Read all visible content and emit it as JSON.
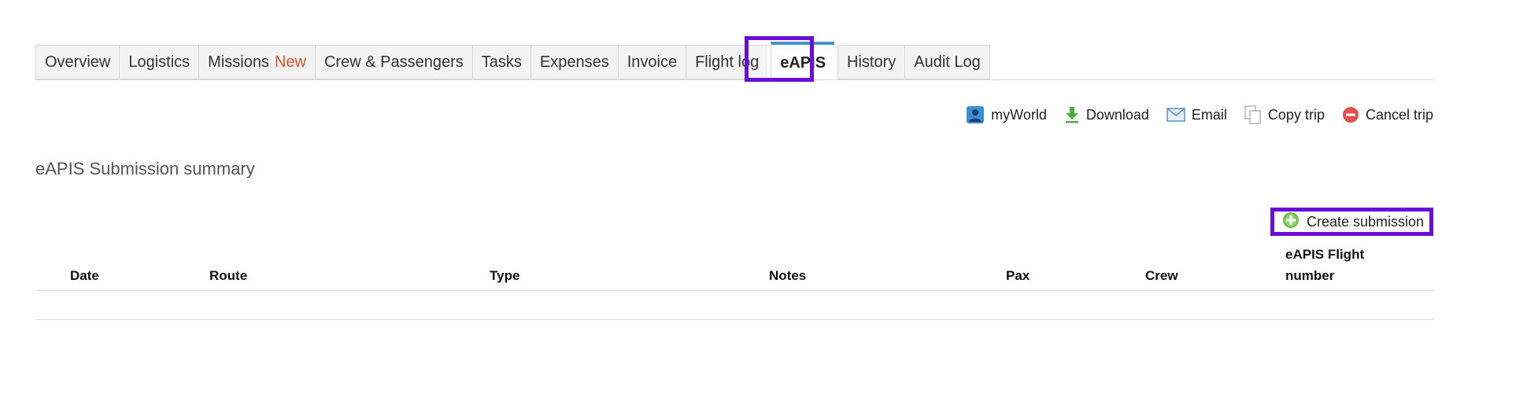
{
  "tabs": [
    {
      "label": "Overview"
    },
    {
      "label": "Logistics"
    },
    {
      "label": "Missions",
      "badge": "New"
    },
    {
      "label": "Crew & Passengers"
    },
    {
      "label": "Tasks"
    },
    {
      "label": "Expenses"
    },
    {
      "label": "Invoice"
    },
    {
      "label": "Flight log"
    },
    {
      "label": "eAPIS",
      "active": true
    },
    {
      "label": "History"
    },
    {
      "label": "Audit Log"
    }
  ],
  "toolbar": {
    "myworld": "myWorld",
    "download": "Download",
    "email": "Email",
    "copy_trip": "Copy trip",
    "cancel_trip": "Cancel trip"
  },
  "section_title": "eAPIS Submission summary",
  "create_button": "Create submission",
  "table": {
    "columns": [
      "Date",
      "Route",
      "Type",
      "Notes",
      "Pax",
      "Crew",
      "eAPIS Flight number"
    ],
    "rows": []
  },
  "colors": {
    "highlight": "#6a0dd9",
    "active_tab_accent": "#4a90c9",
    "new_badge": "#d9532c"
  }
}
